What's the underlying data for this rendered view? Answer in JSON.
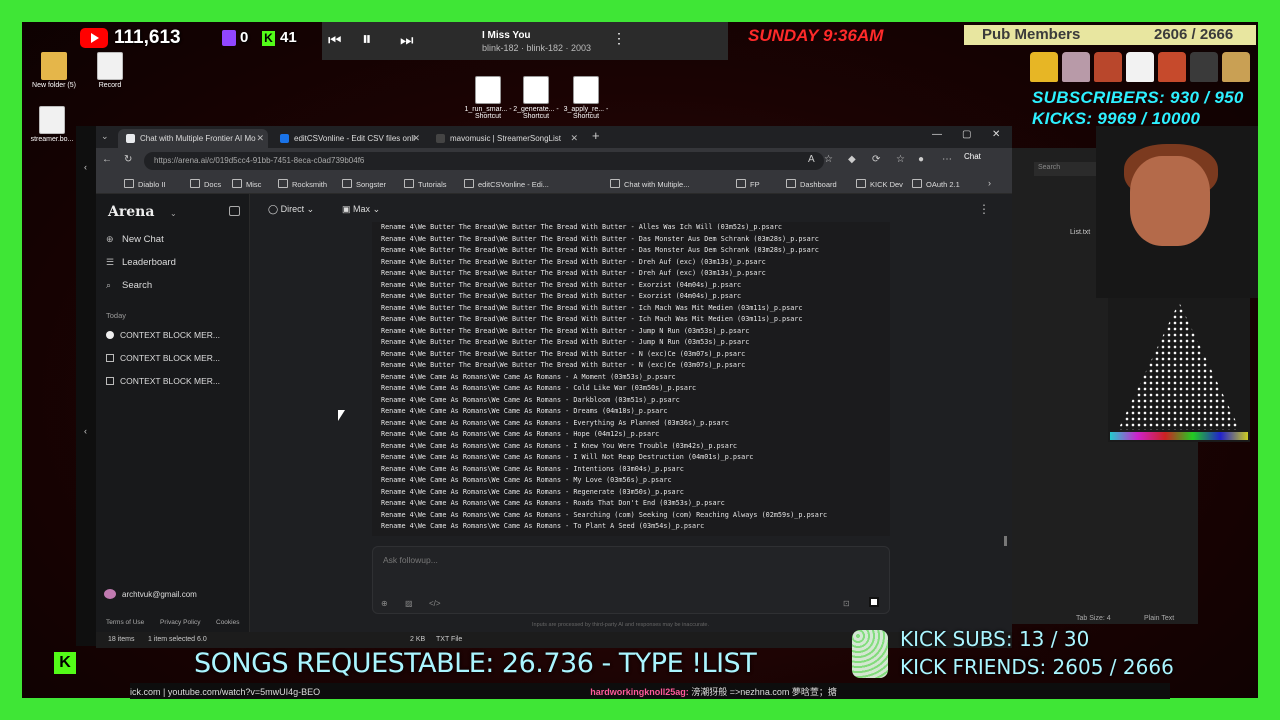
{
  "stream": {
    "youtube_count": "111,613",
    "twitch_count": "0",
    "kick_count": "41",
    "day_time": "SUNDAY 9:36AM",
    "pub_members_label": "Pub Members",
    "pub_members_count": "2606 / 2666",
    "subscribers": "SUBSCRIBERS: 930 / 950",
    "kicks": "KICKS: 9969 / 10000",
    "songs_requestable": "SONGS REQUESTABLE: 26.736 - TYPE !LIST",
    "kick_subs": "KICK SUBS: 13 / 30",
    "kick_friends": "KICK FRIENDS: 2605 / 2666",
    "ticker_text": "ick.com | youtube.com/watch?v=5mwUI4g-BEO",
    "ticker_user": "hardworkingknoll25ag:",
    "ticker_msg": "滂潮犽般 =>nezhna.com 夢晗萱；搪",
    "k_badge": "K"
  },
  "media": {
    "title": "I Miss You",
    "artist": "blink-182 · blink-182 · 2003"
  },
  "desktop": {
    "icons": [
      {
        "label": "New folder (5)"
      },
      {
        "label": "Record"
      },
      {
        "label": "streamer.bo..."
      }
    ],
    "shortcuts": [
      {
        "label": "1_run_smar... - Shortcut"
      },
      {
        "label": "2_generate... - Shortcut"
      },
      {
        "label": "3_apply_re... - Shortcut"
      }
    ]
  },
  "browser": {
    "tabs": [
      {
        "label": "Chat with Multiple Frontier AI Mo",
        "color": "#e8eaed"
      },
      {
        "label": "editCSVonline - Edit CSV files onli",
        "color": "#1a73e8"
      },
      {
        "label": "mavomusic | StreamerSongList",
        "color": "#222"
      }
    ],
    "url": "https://arena.ai/c/019d5cc4-91bb-7451-8eca-c0ad739b04f6",
    "chat_btn": "Chat",
    "bookmarks": [
      "Diablo II",
      "Docs",
      "Misc",
      "Rocksmith",
      "Songster",
      "Tutorials",
      "editCSVonline - Edi...",
      "Chat with Multiple...",
      "FP",
      "Dashboard",
      "KICK Dev",
      "OAuth 2.1"
    ]
  },
  "arena": {
    "logo": "Arena",
    "nav": [
      {
        "label": "New Chat",
        "icon": "plus-circle-icon"
      },
      {
        "label": "Leaderboard",
        "icon": "list-icon"
      },
      {
        "label": "Search",
        "icon": "search-icon"
      }
    ],
    "today_label": "Today",
    "history": [
      "CONTEXT BLOCK MER...",
      "CONTEXT BLOCK MER...",
      "CONTEXT BLOCK MER..."
    ],
    "account": "archtvuk@gmail.com",
    "footer": [
      "Terms of Use",
      "Privacy Policy",
      "Cookies"
    ],
    "mode": "Direct",
    "model": "Max",
    "followup_placeholder": "Ask followup...",
    "disclaimer": "Inputs are processed by third-party AI and responses may be inaccurate."
  },
  "code_lines": [
    "Rename 4\\We Butter The Bread\\We Butter The Bread With Butter - Alles Was Ich Will (03m52s)_p.psarc",
    "Rename 4\\We Butter The Bread\\We Butter The Bread With Butter - Das Monster Aus Dem Schrank (03m28s)_p.psarc",
    "Rename 4\\We Butter The Bread\\We Butter The Bread With Butter - Das Monster Aus Dem Schrank (03m28s)_p.psarc",
    "Rename 4\\We Butter The Bread\\We Butter The Bread With Butter - Dreh Auf (exc) (03m13s)_p.psarc",
    "Rename 4\\We Butter The Bread\\We Butter The Bread With Butter - Dreh Auf (exc) (03m13s)_p.psarc",
    "Rename 4\\We Butter The Bread\\We Butter The Bread With Butter - Exorzist (04m04s)_p.psarc",
    "Rename 4\\We Butter The Bread\\We Butter The Bread With Butter - Exorzist (04m04s)_p.psarc",
    "Rename 4\\We Butter The Bread\\We Butter The Bread With Butter - Ich Mach Was Mit Medien (03m11s)_p.psarc",
    "Rename 4\\We Butter The Bread\\We Butter The Bread With Butter - Ich Mach Was Mit Medien (03m11s)_p.psarc",
    "Rename 4\\We Butter The Bread\\We Butter The Bread With Butter - Jump N Run (03m53s)_p.psarc",
    "Rename 4\\We Butter The Bread\\We Butter The Bread With Butter - Jump N Run (03m53s)_p.psarc",
    "Rename 4\\We Butter The Bread\\We Butter The Bread With Butter - N (exc)Ce (03m07s)_p.psarc",
    "Rename 4\\We Butter The Bread\\We Butter The Bread With Butter - N (exc)Ce (03m07s)_p.psarc",
    "Rename 4\\We Came As Romans\\We Came As Romans - A Moment (03m53s)_p.psarc",
    "Rename 4\\We Came As Romans\\We Came As Romans - Cold Like War (03m50s)_p.psarc",
    "Rename 4\\We Came As Romans\\We Came As Romans - Darkbloom (03m51s)_p.psarc",
    "Rename 4\\We Came As Romans\\We Came As Romans - Dreams (04m18s)_p.psarc",
    "Rename 4\\We Came As Romans\\We Came As Romans - Everything As Planned (03m36s)_p.psarc",
    "Rename 4\\We Came As Romans\\We Came As Romans - Hope (04m12s)_p.psarc",
    "Rename 4\\We Came As Romans\\We Came As Romans - I Knew You Were Trouble (03m42s)_p.psarc",
    "Rename 4\\We Came As Romans\\We Came As Romans - I Will Not Reap Destruction (04m01s)_p.psarc",
    "Rename 4\\We Came As Romans\\We Came As Romans - Intentions (03m04s)_p.psarc",
    "Rename 4\\We Came As Romans\\We Came As Romans - My Love (03m56s)_p.psarc",
    "Rename 4\\We Came As Romans\\We Came As Romans - Regenerate (03m50s)_p.psarc",
    "Rename 4\\We Came As Romans\\We Came As Romans - Roads That Don't End (03m53s)_p.psarc",
    "Rename 4\\We Came As Romans\\We Came As Romans - Searching (com) Seeking (com) Reaching Always (02m59s)_p.psarc",
    "Rename 4\\We Came As Romans\\We Came As Romans - To Plant A Seed (03m54s)_p.psarc"
  ],
  "notepad": {
    "tab": "List.txt",
    "status_tab": "Tab Size: 4",
    "status_type": "Plain Text",
    "search": "Search"
  },
  "explorer": {
    "items": "18 items",
    "selected": "1 item selected  6.0",
    "size": "2 KB",
    "type": "TXT File"
  },
  "colors": {
    "frame_green": "#3fe636",
    "cyan_text": "#2df0ff",
    "day_red": "#ff2a2a"
  }
}
